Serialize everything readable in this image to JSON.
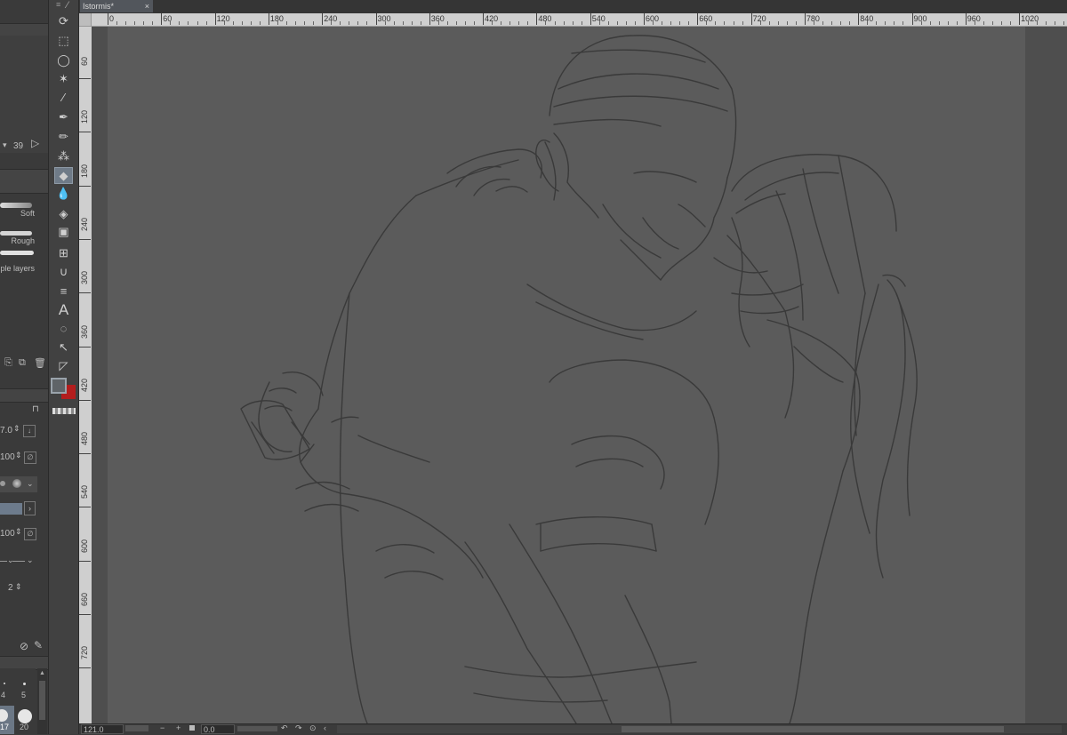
{
  "document": {
    "tab_title": "Istormis*",
    "close_glyph": "×"
  },
  "ruler": {
    "top_ticks": [
      "0",
      "60",
      "120",
      "180",
      "240",
      "300",
      "360",
      "420",
      "480",
      "540",
      "600",
      "660",
      "720",
      "780",
      "840",
      "900",
      "960",
      "1020"
    ],
    "left_ticks": [
      "60",
      "120",
      "180",
      "240",
      "300",
      "360",
      "420",
      "480",
      "540",
      "600",
      "660",
      "720"
    ]
  },
  "brush_panel": {
    "brush_count": "39",
    "presets": [
      "Soft",
      "Rough",
      "Multiple layers"
    ]
  },
  "tool_properties": {
    "brush_size": "7.0",
    "opacity": "100",
    "density": "100",
    "stroke_step": "2"
  },
  "size_palette": {
    "labels": [
      "4",
      "5",
      "17",
      "20"
    ]
  },
  "status_bar": {
    "zoom": "121.0",
    "angle": "0.0"
  },
  "colors": {
    "main_color": "#5f6468",
    "sub_color": "#b31d1d",
    "canvas_bg": "#5b5b5b",
    "line_color": "#3a3a3a"
  },
  "icons": [
    "rotate-icon",
    "selection-move-icon",
    "lasso-icon",
    "magic-wand-icon",
    "eyedropper-icon",
    "pen-icon",
    "pencil-icon",
    "airbrush-icon",
    "eraser-icon",
    "blend-icon",
    "fill-icon",
    "gradient-icon",
    "frame-icon",
    "ruler-icon",
    "hatch-icon",
    "text-icon",
    "balloon-icon",
    "object-select-icon",
    "correct-line-icon"
  ]
}
